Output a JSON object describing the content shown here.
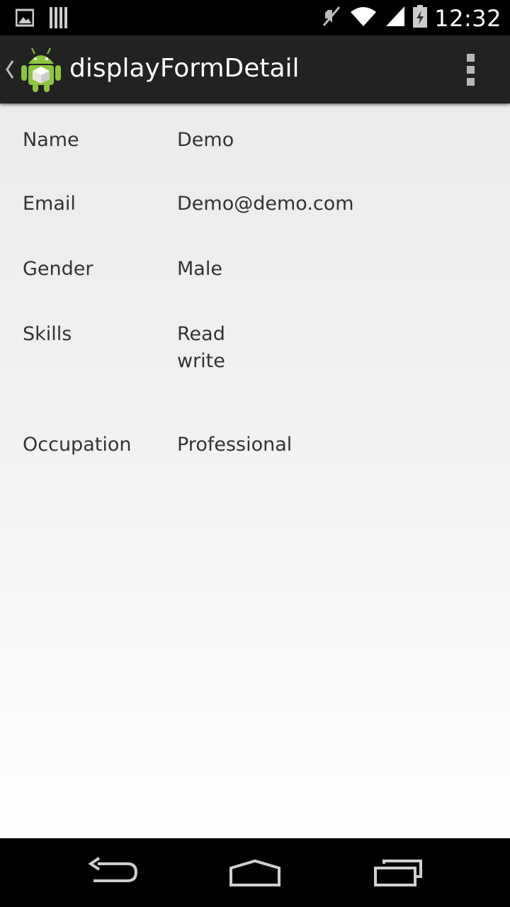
{
  "status_bar": {
    "time": "12:32",
    "icons": [
      "gallery-notification-icon",
      "barcode-notification-icon",
      "mute-icon",
      "wifi-icon",
      "signal-icon",
      "battery-charging-icon"
    ]
  },
  "action_bar": {
    "title": "displayFormDetail",
    "icons": [
      "up-caret-icon",
      "android-app-icon",
      "overflow-menu-icon"
    ]
  },
  "details": [
    {
      "label": "Name",
      "value": "Demo"
    },
    {
      "label": "Email",
      "value": "Demo@demo.com"
    },
    {
      "label": "Gender",
      "value": "Male"
    },
    {
      "label": "Skills",
      "value_lines": [
        "Read",
        "write"
      ]
    },
    {
      "label": "Occupation",
      "value": "Professional"
    }
  ],
  "nav_bar": {
    "icons": [
      "back-icon",
      "home-icon",
      "recent-apps-icon"
    ]
  }
}
